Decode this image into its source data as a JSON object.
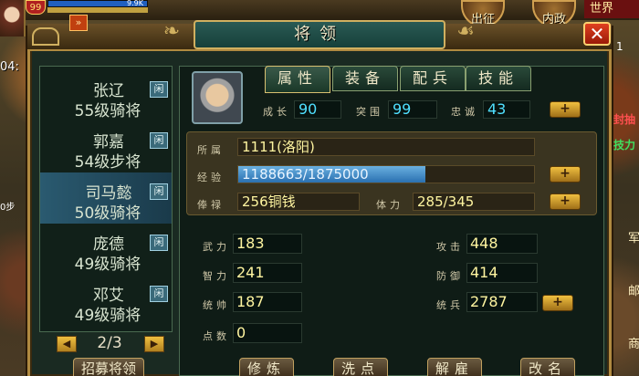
{
  "hud": {
    "player_level": "99",
    "hp_text": "9.9K",
    "expedition_label": "出征",
    "politics_label": "内政",
    "world_label": "世界",
    "side_number": "1",
    "side_red_text": "封抽",
    "side_green_text": "技力",
    "side_chars": [
      "军",
      "邮",
      "商"
    ],
    "left_time": "04:",
    "left_fragment": "0步"
  },
  "dialog": {
    "title": "将领",
    "collapse_icon": "»",
    "close_icon": "✕"
  },
  "general_list": {
    "idle_label": "闲",
    "items": [
      {
        "name": "张辽",
        "level": "55级骑将",
        "selected": false
      },
      {
        "name": "郭嘉",
        "level": "54级步将",
        "selected": false
      },
      {
        "name": "司马懿",
        "level": "50级骑将",
        "selected": true
      },
      {
        "name": "庞德",
        "level": "49级骑将",
        "selected": false
      },
      {
        "name": "邓艾",
        "level": "49级骑将",
        "selected": false
      }
    ],
    "page": "2/3",
    "prev_icon": "◀",
    "next_icon": "▶",
    "recruit_label": "招募将领"
  },
  "tabs": {
    "attributes": "属性",
    "equipment": "装备",
    "troops": "配兵",
    "skills": "技能"
  },
  "top_fields": {
    "growth_label": "成长",
    "growth_value": "90",
    "breakthrough_label": "突围",
    "breakthrough_value": "99",
    "loyalty_label": "忠诚",
    "loyalty_value": "43"
  },
  "info": {
    "belongs_label": "所属",
    "belongs_value": "1111(洛阳)",
    "exp_label": "经验",
    "exp_value": "1188663/1875000",
    "exp_fraction": 0.634,
    "salary_label": "俸禄",
    "salary_value": "256铜钱",
    "stamina_label": "体力",
    "stamina_value": "285/345"
  },
  "stats": {
    "force_label": "武力",
    "force_value": "183",
    "intel_label": "智力",
    "intel_value": "241",
    "command_label": "统帅",
    "command_value": "187",
    "points_label": "点数",
    "points_value": "0",
    "attack_label": "攻击",
    "attack_value": "448",
    "defense_label": "防御",
    "defense_value": "414",
    "troops_label": "统兵",
    "troops_value": "2787"
  },
  "plus_label": "+",
  "actions": {
    "train": "修炼",
    "wash": "洗点",
    "dismiss": "解雇",
    "rename": "改名"
  },
  "colors": {
    "value_cyan": "#50e0ff",
    "value_yellow": "#fff5a0",
    "gold_border": "#b08a40"
  }
}
